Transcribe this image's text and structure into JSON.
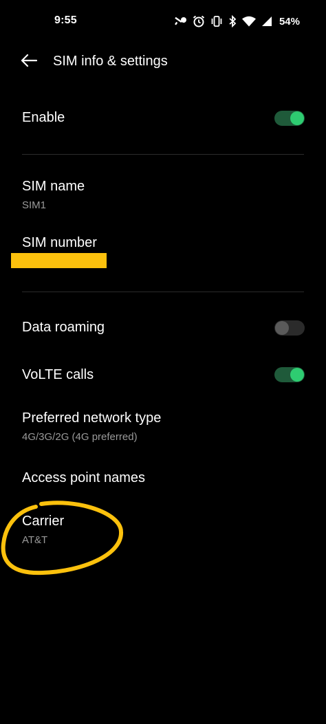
{
  "status_bar": {
    "time": "9:55",
    "battery": "54%",
    "icons": [
      "key-icon",
      "alarm-icon",
      "vibrate-icon",
      "bluetooth-icon",
      "wifi-icon",
      "signal-icon",
      "battery-icon"
    ]
  },
  "header": {
    "title": "SIM info & settings",
    "back_icon": "arrow-left-icon"
  },
  "rows": {
    "enable": {
      "title": "Enable",
      "toggle_on": true
    },
    "sim_name": {
      "title": "SIM name",
      "value": "SIM1"
    },
    "sim_number": {
      "title": "SIM number"
    },
    "data_roaming": {
      "title": "Data roaming",
      "toggle_on": false
    },
    "volte": {
      "title": "VoLTE calls",
      "toggle_on": true
    },
    "network_type": {
      "title": "Preferred network type",
      "value": "4G/3G/2G (4G preferred)"
    },
    "apn": {
      "title": "Access point names"
    },
    "carrier": {
      "title": "Carrier",
      "value": "AT&T"
    }
  },
  "colors": {
    "background": "#000000",
    "toggle_on_knob": "#2ecc71",
    "toggle_on_track": "#1f5a3a",
    "toggle_off_knob": "#5a5a5a",
    "toggle_off_track": "#2b2b2b",
    "annotation_yellow": "#fcc10d",
    "secondary_text": "#9a9a9a"
  }
}
